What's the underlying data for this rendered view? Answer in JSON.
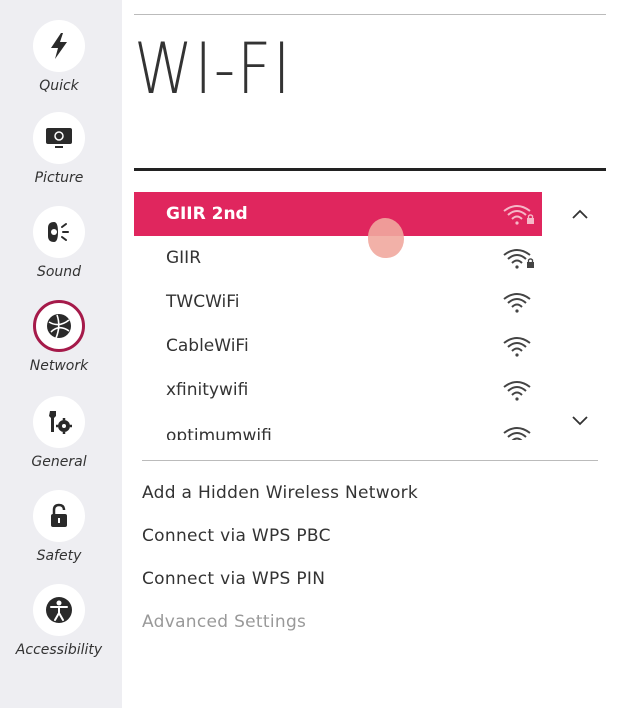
{
  "sidebar": {
    "items": [
      {
        "label": "Quick",
        "icon": "lightning-icon"
      },
      {
        "label": "Picture",
        "icon": "monitor-icon"
      },
      {
        "label": "Sound",
        "icon": "speaker-icon"
      },
      {
        "label": "Network",
        "icon": "globe-icon",
        "selected": true
      },
      {
        "label": "General",
        "icon": "wrench-gear-icon"
      },
      {
        "label": "Safety",
        "icon": "lock-icon"
      },
      {
        "label": "Accessibility",
        "icon": "person-icon"
      }
    ]
  },
  "page": {
    "title": "WI-FI"
  },
  "networks": [
    {
      "name": "GIIR 2nd",
      "locked": true,
      "selected": true
    },
    {
      "name": "GIIR",
      "locked": true
    },
    {
      "name": "TWCWiFi",
      "locked": false
    },
    {
      "name": "CableWiFi",
      "locked": false
    },
    {
      "name": "xfinitywifi",
      "locked": false
    },
    {
      "name": "optimumwifi",
      "locked": false
    }
  ],
  "options": {
    "add_hidden": "Add a Hidden Wireless Network",
    "wps_pbc": "Connect via WPS PBC",
    "wps_pin": "Connect via WPS PIN",
    "advanced": "Advanced Settings"
  },
  "colors": {
    "accent": "#e0265e",
    "selected_ring": "#a51a4a"
  }
}
